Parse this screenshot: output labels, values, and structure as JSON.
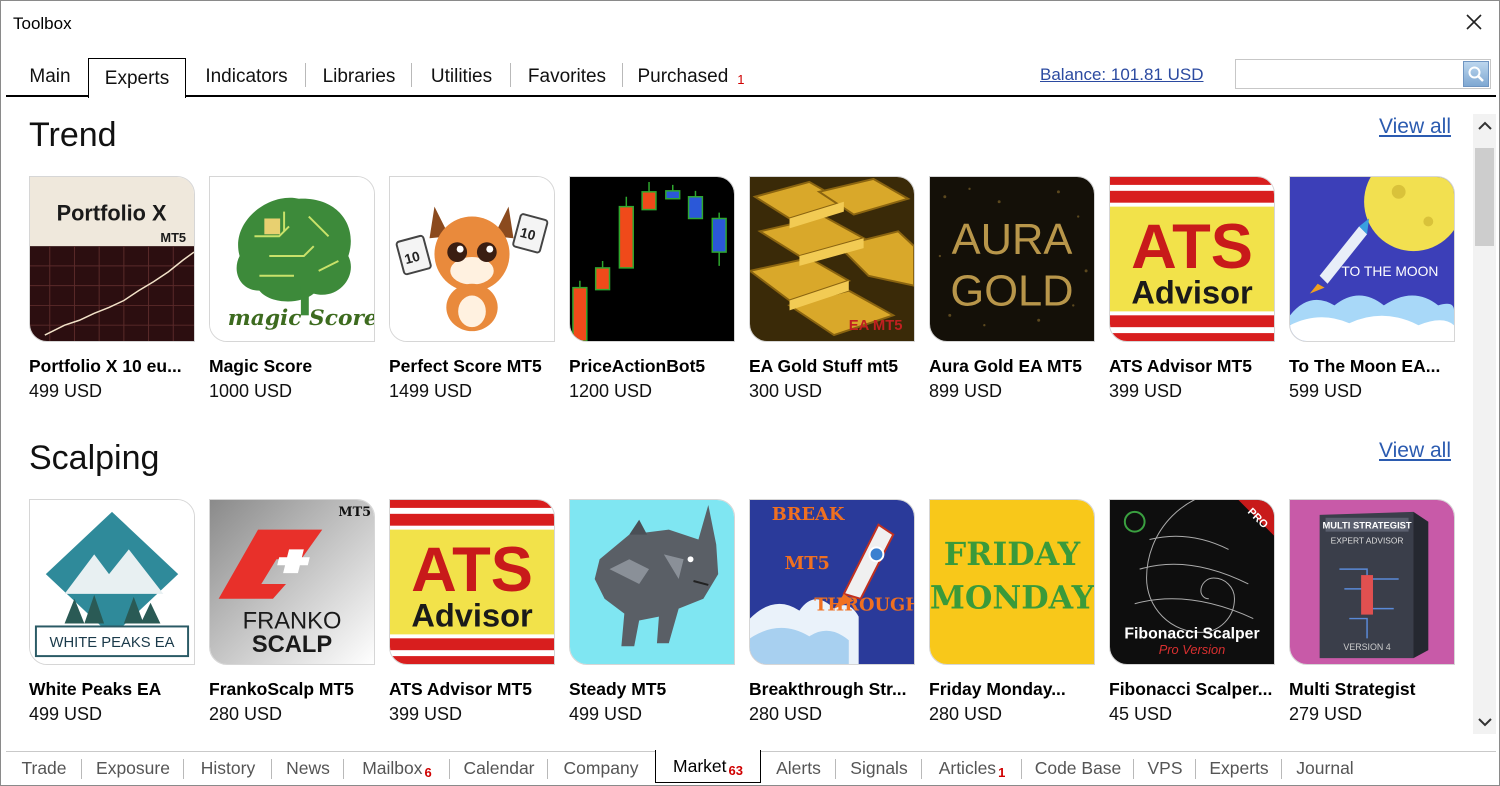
{
  "window": {
    "title": "Toolbox"
  },
  "top_tabs": [
    {
      "label": "Main"
    },
    {
      "label": "Experts"
    },
    {
      "label": "Indicators"
    },
    {
      "label": "Libraries"
    },
    {
      "label": "Utilities"
    },
    {
      "label": "Favorites"
    },
    {
      "label": "Purchased",
      "badge": "1"
    }
  ],
  "active_top_tab": "Experts",
  "balance": "Balance: 101.81 USD",
  "search": {
    "value": "",
    "placeholder": ""
  },
  "sections": [
    {
      "title": "Trend",
      "view_all": "View all",
      "products": [
        {
          "name": "Portfolio X 10 eu...",
          "price": "499 USD",
          "thumb_text": [
            "Portfolio X",
            "MT5"
          ]
        },
        {
          "name": "Magic Score",
          "price": "1000 USD",
          "thumb_text": [
            "magic Score"
          ]
        },
        {
          "name": "Perfect Score MT5",
          "price": "1499 USD",
          "thumb_text": [
            "10",
            "10"
          ]
        },
        {
          "name": "PriceActionBot5",
          "price": "1200 USD",
          "thumb_text": []
        },
        {
          "name": "EA Gold Stuff mt5",
          "price": "300 USD",
          "thumb_text": [
            "EA MT5"
          ]
        },
        {
          "name": "Aura Gold EA MT5",
          "price": "899 USD",
          "thumb_text": [
            "AURA",
            "GOLD"
          ]
        },
        {
          "name": "ATS Advisor MT5",
          "price": "399 USD",
          "thumb_text": [
            "ATS",
            "Advisor"
          ]
        },
        {
          "name": "To The Moon EA...",
          "price": "599 USD",
          "thumb_text": [
            "TO THE MOON"
          ]
        }
      ]
    },
    {
      "title": "Scalping",
      "view_all": "View all",
      "products": [
        {
          "name": "White Peaks EA",
          "price": "499 USD",
          "thumb_text": [
            "WHITE PEAKS EA"
          ]
        },
        {
          "name": "FrankoScalp MT5",
          "price": "280 USD",
          "thumb_text": [
            "MT5",
            "FRANKO",
            "SCALP"
          ]
        },
        {
          "name": "ATS Advisor MT5",
          "price": "399 USD",
          "thumb_text": [
            "ATS",
            "Advisor"
          ]
        },
        {
          "name": "Steady MT5",
          "price": "499 USD",
          "thumb_text": []
        },
        {
          "name": "Breakthrough Str...",
          "price": "280 USD",
          "thumb_text": [
            "BREAK",
            "MT5",
            "THROUGH"
          ]
        },
        {
          "name": "Friday Monday...",
          "price": "280 USD",
          "thumb_text": [
            "FRIDAY",
            "MONDAY"
          ]
        },
        {
          "name": "Fibonacci Scalper...",
          "price": "45 USD",
          "thumb_text": [
            "PRO",
            "Fibonacci Scalper",
            "Pro Version"
          ]
        },
        {
          "name": "Multi Strategist",
          "price": "279 USD",
          "thumb_text": [
            "MULTI STRATEGIST",
            "EXPERT ADVISOR",
            "VERSION 4"
          ]
        }
      ]
    }
  ],
  "bottom_tabs": [
    {
      "label": "Trade"
    },
    {
      "label": "Exposure"
    },
    {
      "label": "History"
    },
    {
      "label": "News"
    },
    {
      "label": "Mailbox",
      "badge": "6"
    },
    {
      "label": "Calendar"
    },
    {
      "label": "Company"
    },
    {
      "label": "Market",
      "badge": "63"
    },
    {
      "label": "Alerts"
    },
    {
      "label": "Signals"
    },
    {
      "label": "Articles",
      "badge": "1"
    },
    {
      "label": "Code Base"
    },
    {
      "label": "VPS"
    },
    {
      "label": "Experts"
    },
    {
      "label": "Journal"
    }
  ],
  "active_bottom_tab": "Market",
  "colors": {
    "link": "#2b5bb0",
    "badge": "#d00000",
    "accent": "#000000"
  }
}
